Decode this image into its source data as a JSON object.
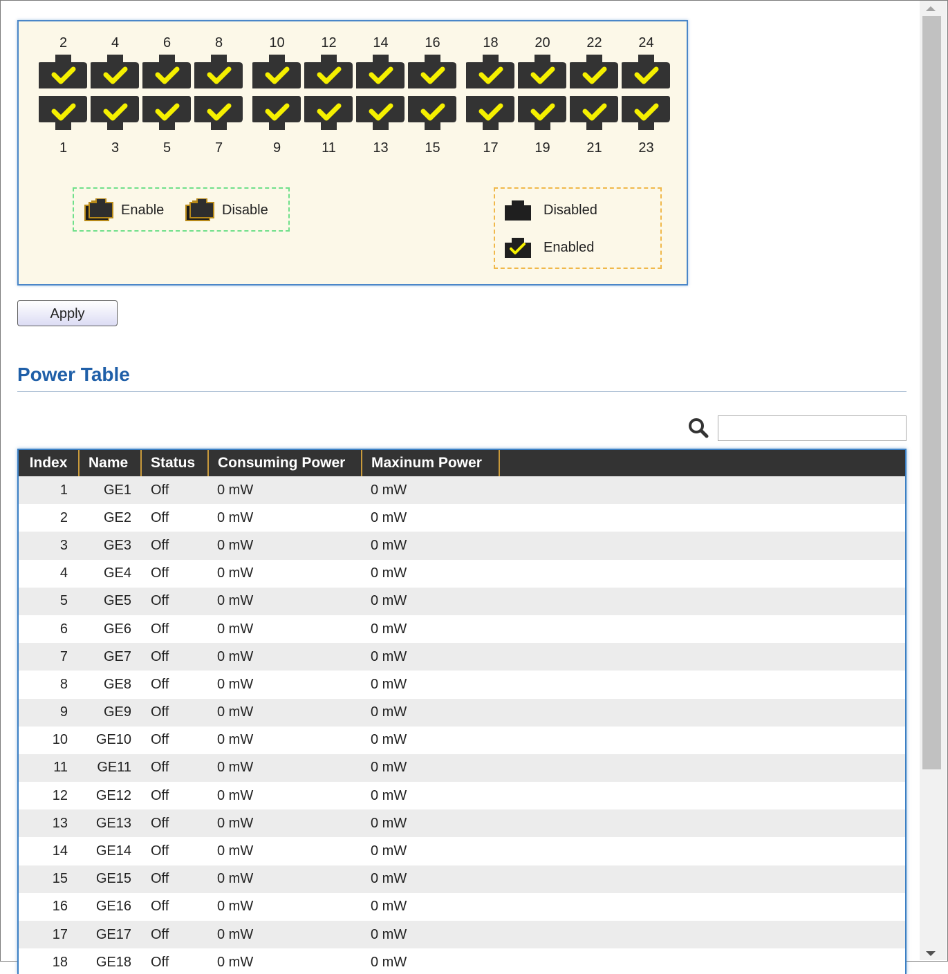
{
  "port_panel": {
    "top_ports": [
      "2",
      "4",
      "6",
      "8",
      "10",
      "12",
      "14",
      "16",
      "18",
      "20",
      "22",
      "24"
    ],
    "bottom_ports": [
      "1",
      "3",
      "5",
      "7",
      "9",
      "11",
      "13",
      "15",
      "17",
      "19",
      "21",
      "23"
    ],
    "port_state": "enabled",
    "check_color": "#f5f000",
    "port_color": "#333333",
    "select_legend": {
      "enable_label": "Enable",
      "disable_label": "Disable"
    },
    "status_legend": {
      "disabled_label": "Disabled",
      "enabled_label": "Enabled"
    }
  },
  "apply_label": "Apply",
  "power_table": {
    "title": "Power Table",
    "search": {
      "icon": "search-icon",
      "value": ""
    },
    "columns": [
      "Index",
      "Name",
      "Status",
      "Consuming Power",
      "Maxinum Power"
    ],
    "rows": [
      [
        "1",
        "GE1",
        "Off",
        "0 mW",
        "0 mW"
      ],
      [
        "2",
        "GE2",
        "Off",
        "0 mW",
        "0 mW"
      ],
      [
        "3",
        "GE3",
        "Off",
        "0 mW",
        "0 mW"
      ],
      [
        "4",
        "GE4",
        "Off",
        "0 mW",
        "0 mW"
      ],
      [
        "5",
        "GE5",
        "Off",
        "0 mW",
        "0 mW"
      ],
      [
        "6",
        "GE6",
        "Off",
        "0 mW",
        "0 mW"
      ],
      [
        "7",
        "GE7",
        "Off",
        "0 mW",
        "0 mW"
      ],
      [
        "8",
        "GE8",
        "Off",
        "0 mW",
        "0 mW"
      ],
      [
        "9",
        "GE9",
        "Off",
        "0 mW",
        "0 mW"
      ],
      [
        "10",
        "GE10",
        "Off",
        "0 mW",
        "0 mW"
      ],
      [
        "11",
        "GE11",
        "Off",
        "0 mW",
        "0 mW"
      ],
      [
        "12",
        "GE12",
        "Off",
        "0 mW",
        "0 mW"
      ],
      [
        "13",
        "GE13",
        "Off",
        "0 mW",
        "0 mW"
      ],
      [
        "14",
        "GE14",
        "Off",
        "0 mW",
        "0 mW"
      ],
      [
        "15",
        "GE15",
        "Off",
        "0 mW",
        "0 mW"
      ],
      [
        "16",
        "GE16",
        "Off",
        "0 mW",
        "0 mW"
      ],
      [
        "17",
        "GE17",
        "Off",
        "0 mW",
        "0 mW"
      ],
      [
        "18",
        "GE18",
        "Off",
        "0 mW",
        "0 mW"
      ]
    ]
  },
  "colors": {
    "panel_bg": "#fcf8e8",
    "panel_border": "#4a86c8",
    "title_blue": "#1f5fa8",
    "header_bg": "#333333",
    "header_divider": "#c99a3b"
  }
}
